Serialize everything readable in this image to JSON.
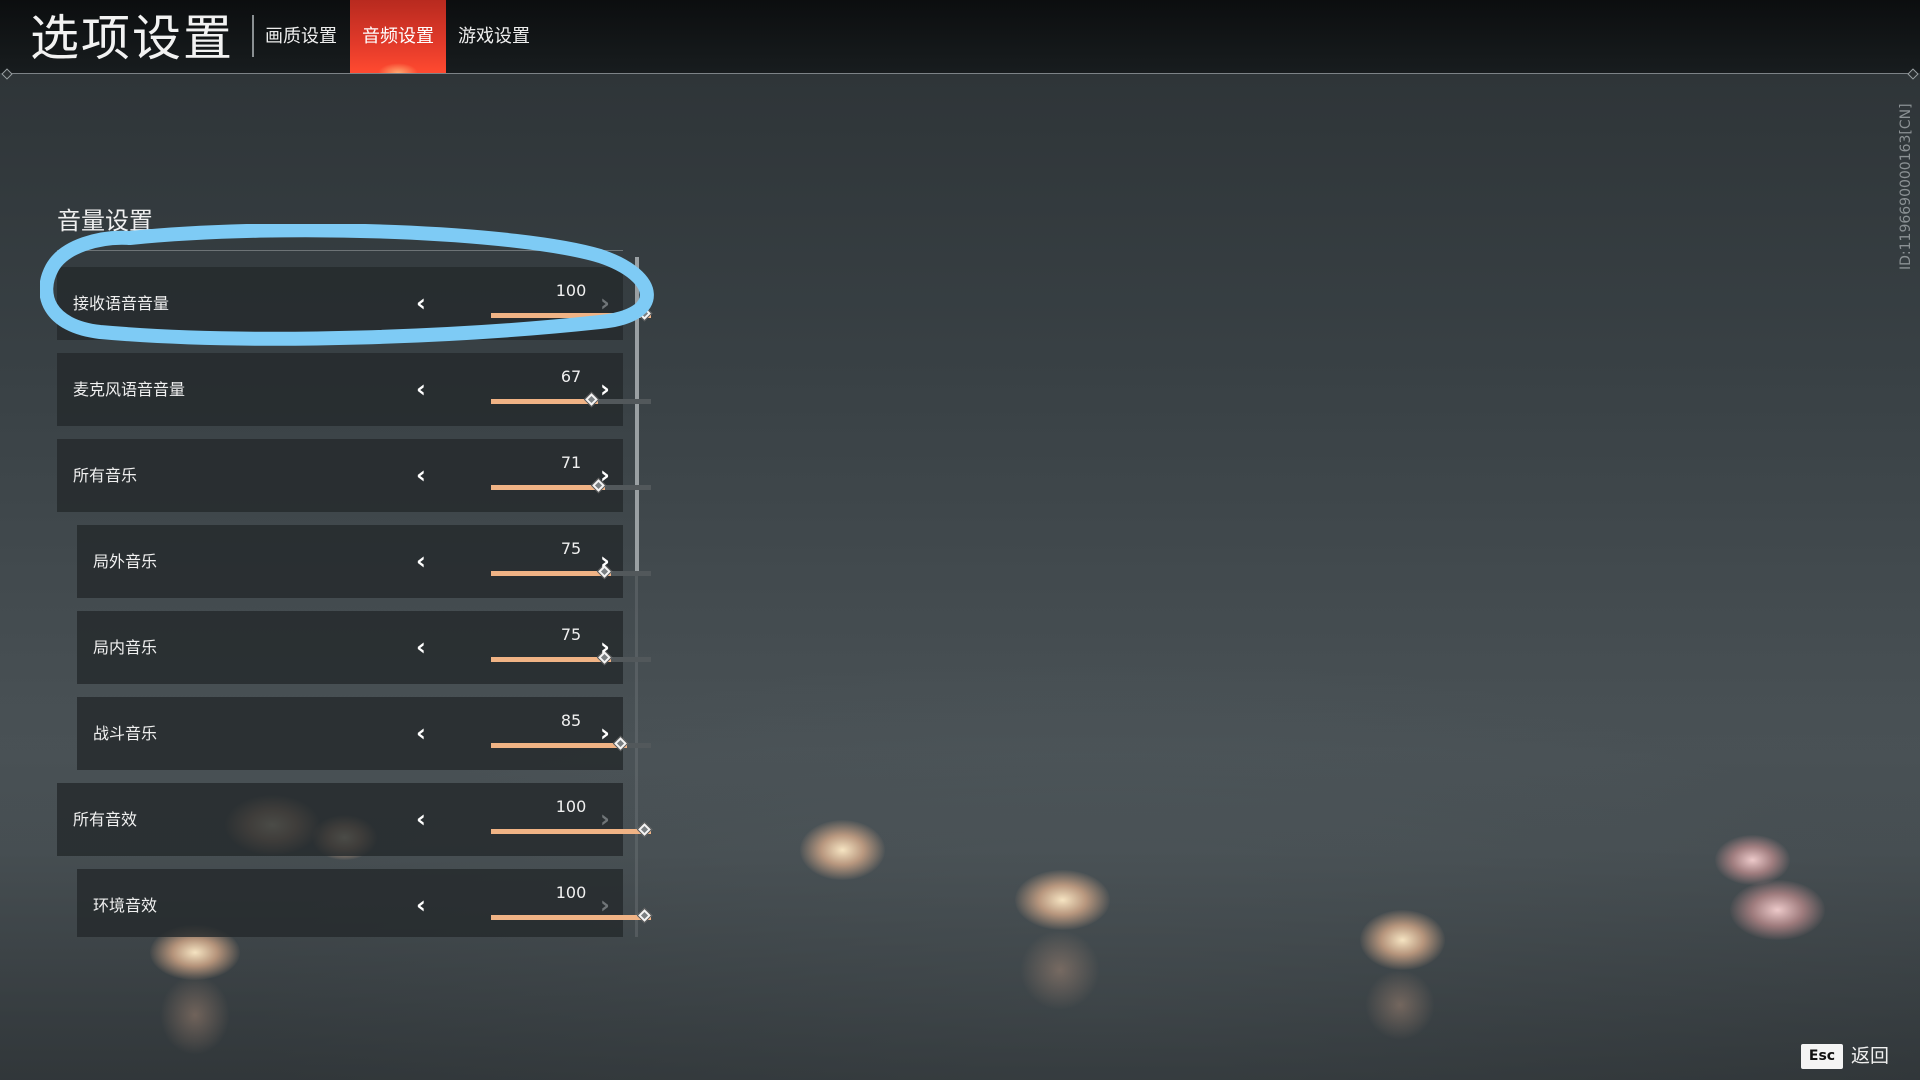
{
  "header": {
    "title": "选项设置",
    "tabs": [
      {
        "label": "画质设置",
        "active": false
      },
      {
        "label": "音频设置",
        "active": true
      },
      {
        "label": "游戏设置",
        "active": false
      }
    ]
  },
  "section": {
    "title": "音量设置"
  },
  "volume_rows": [
    {
      "label": "接收语音音量",
      "value": "100",
      "level": 100
    },
    {
      "label": "麦克风语音音量",
      "value": "67",
      "level": 67
    },
    {
      "label": "所有音乐",
      "value": "71",
      "level": 71
    },
    {
      "label": "局外音乐",
      "value": "75",
      "level": 75
    },
    {
      "label": "局内音乐",
      "value": "75",
      "level": 75
    },
    {
      "label": "战斗音乐",
      "value": "85",
      "level": 85
    },
    {
      "label": "所有音效",
      "value": "100",
      "level": 100
    },
    {
      "label": "环境音效",
      "value": "100",
      "level": 100
    }
  ],
  "icons": {
    "decrease": "chevron-left-icon",
    "increase": "chevron-right-icon",
    "slider_thumb": "diamond-icon"
  },
  "side_id": "ID:1196690000163[CN]",
  "footer": {
    "esc_key": "Esc",
    "esc_label": "返回"
  },
  "colors": {
    "accent": "#e23a2a",
    "slider_fill": "#f0b385",
    "annotation": "#7ecbf5"
  }
}
